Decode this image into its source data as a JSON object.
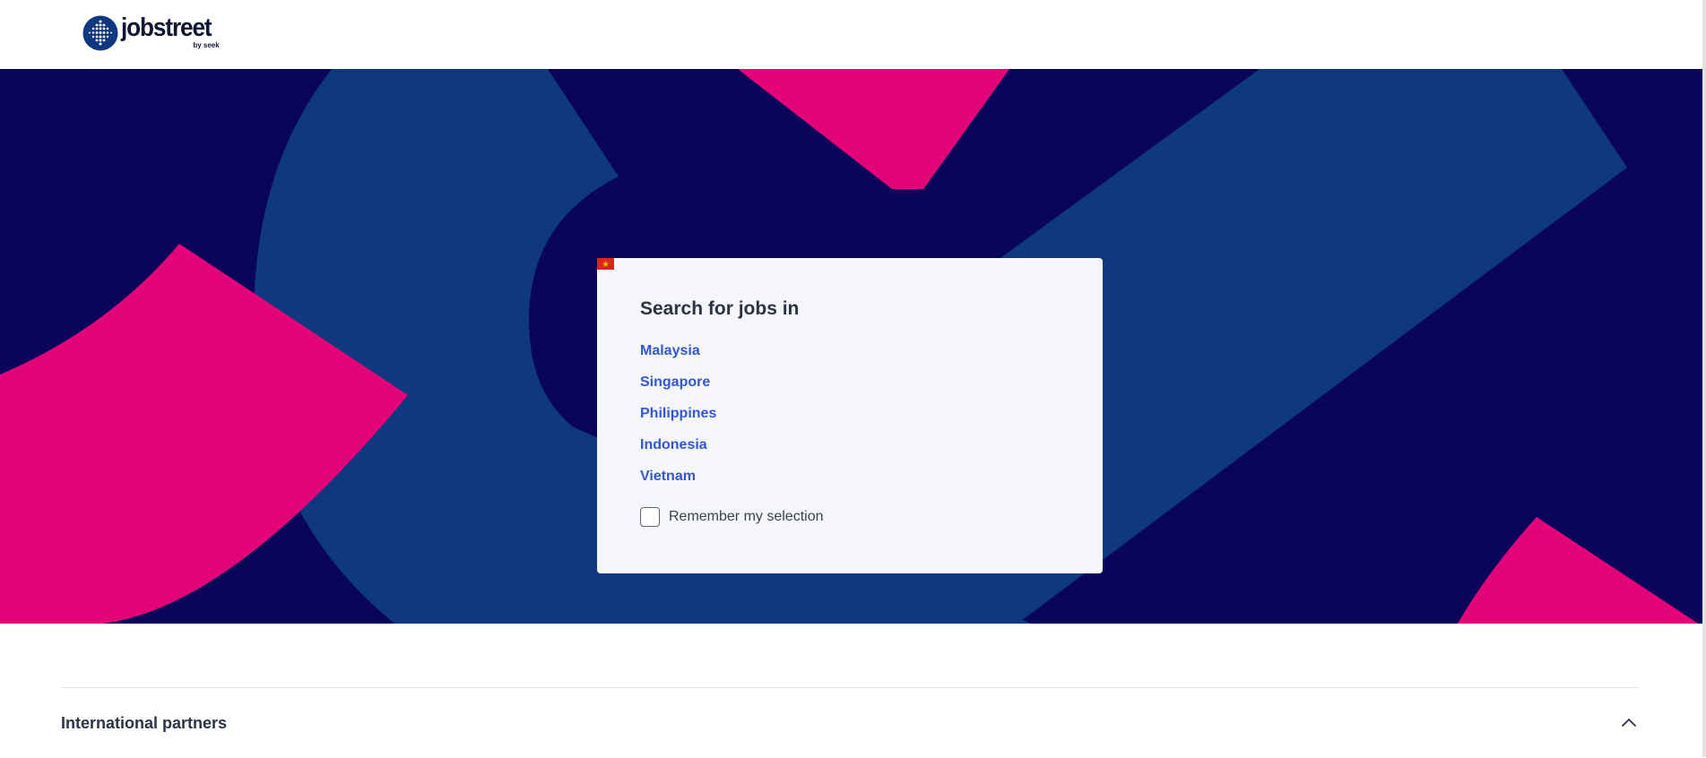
{
  "header": {
    "brand_name": "jobstreet",
    "brand_sub": "by seek"
  },
  "hero": {
    "colors": {
      "navy": "#09055a",
      "blue": "#0e387f",
      "pink": "#e5037a"
    }
  },
  "card": {
    "title": "Search for jobs in",
    "countries": [
      {
        "label": "Malaysia",
        "flag_icon": "malaysia-flag-icon"
      },
      {
        "label": "Singapore",
        "flag_icon": "singapore-flag-icon"
      },
      {
        "label": "Philippines",
        "flag_icon": "philippines-flag-icon"
      },
      {
        "label": "Indonesia",
        "flag_icon": "indonesia-flag-icon"
      },
      {
        "label": "Vietnam",
        "flag_icon": "vietnam-flag-icon"
      }
    ],
    "remember_label": "Remember my selection",
    "remember_checked": false,
    "link_color": "#3257d6"
  },
  "footer": {
    "partners_title": "International partners",
    "partners_expanded": true
  }
}
